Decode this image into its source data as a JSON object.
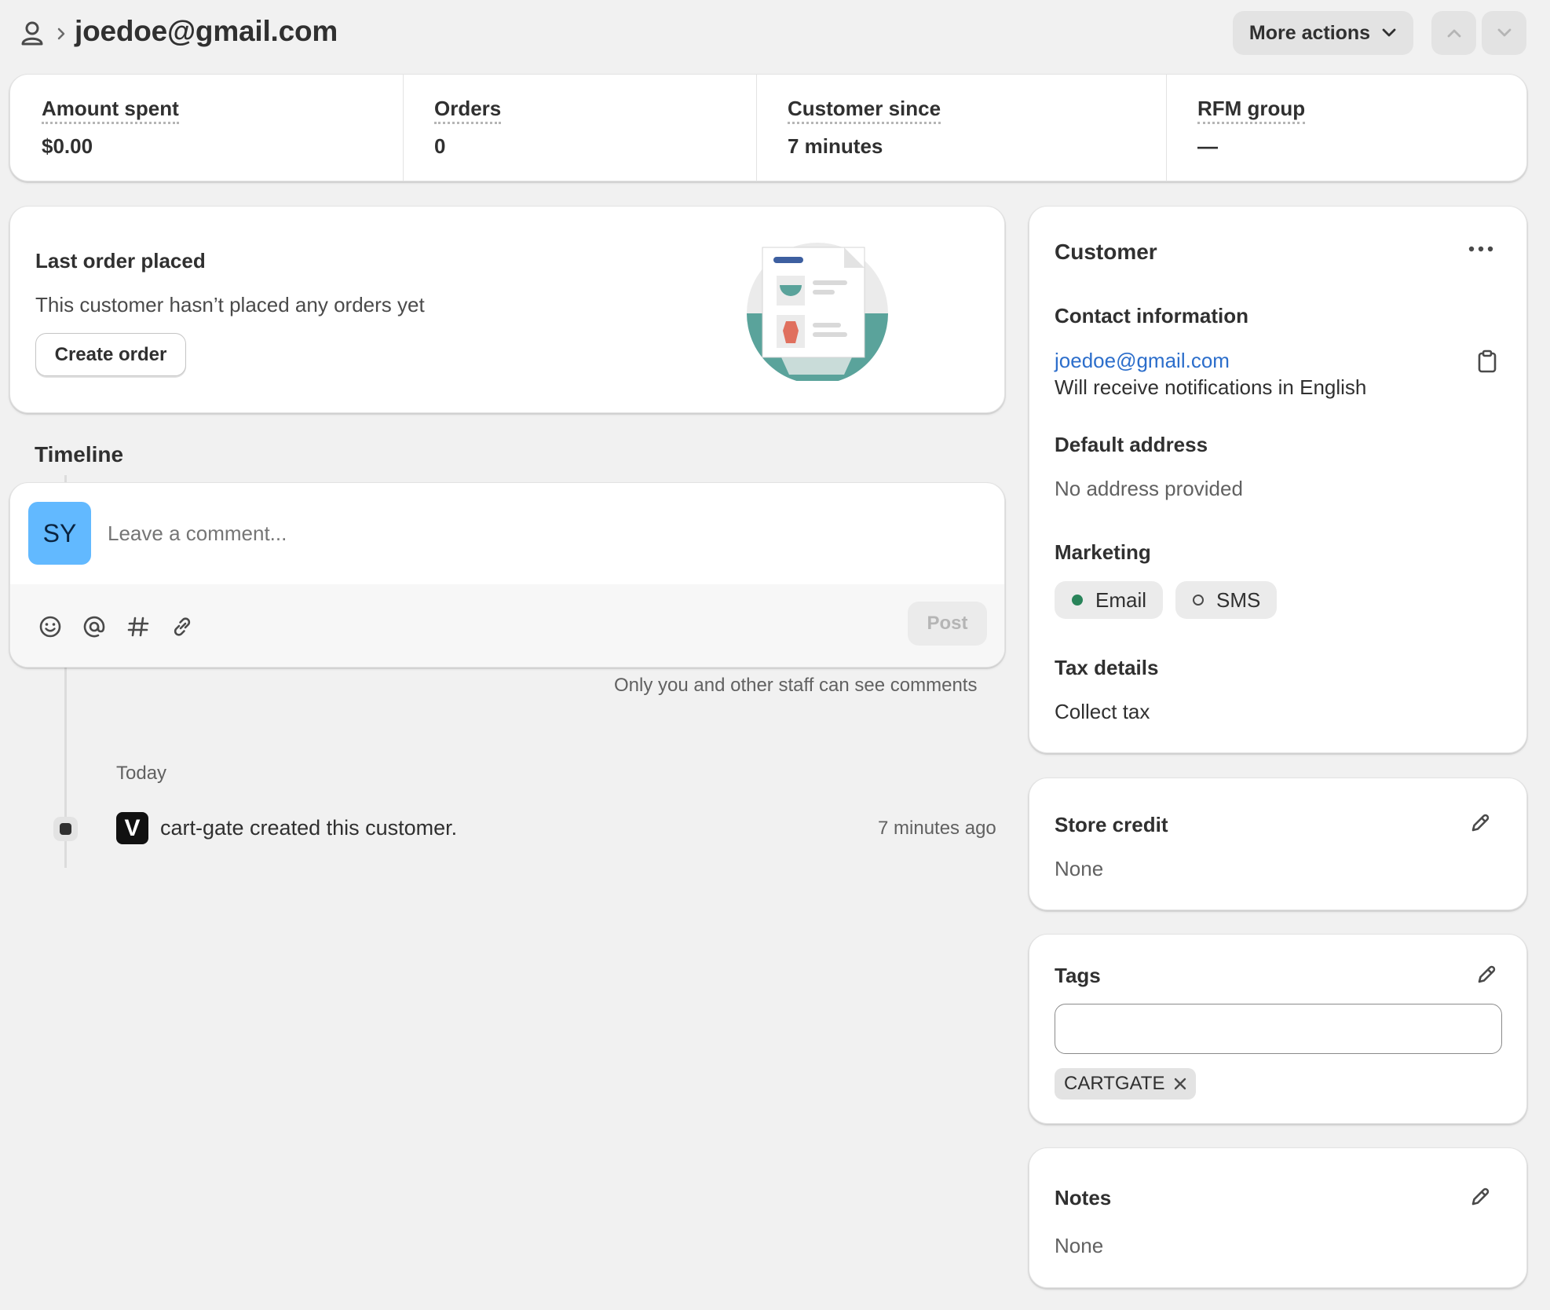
{
  "header": {
    "email": "joedoe@gmail.com",
    "more_actions_label": "More actions"
  },
  "stats": [
    {
      "label": "Amount spent",
      "value": "$0.00"
    },
    {
      "label": "Orders",
      "value": "0"
    },
    {
      "label": "Customer since",
      "value": "7 minutes"
    },
    {
      "label": "RFM group",
      "value": "—"
    }
  ],
  "last_order": {
    "title": "Last order placed",
    "message": "This customer hasn’t placed any orders yet",
    "create_order_label": "Create order"
  },
  "timeline": {
    "title": "Timeline",
    "avatar_initials": "SY",
    "comment_placeholder": "Leave a comment...",
    "post_label": "Post",
    "staff_note": "Only you and other staff can see comments",
    "day_label": "Today",
    "events": [
      {
        "text": "cart-gate created this customer.",
        "time": "7 minutes ago",
        "app_icon_letter": "V"
      }
    ]
  },
  "customer_card": {
    "title": "Customer",
    "contact_heading": "Contact information",
    "email": "joedoe@gmail.com",
    "notification_text": "Will receive notifications in English",
    "address_heading": "Default address",
    "address_text": "No address provided",
    "marketing_heading": "Marketing",
    "marketing_email_label": "Email",
    "marketing_sms_label": "SMS",
    "tax_heading": "Tax details",
    "tax_text": "Collect tax"
  },
  "store_credit": {
    "title": "Store credit",
    "value": "None"
  },
  "tags": {
    "title": "Tags",
    "input_value": "",
    "items": [
      "CARTGATE"
    ]
  },
  "notes": {
    "title": "Notes",
    "value": "None"
  },
  "colors": {
    "link": "#2c6ecb",
    "subscribed_dot": "#29845a",
    "avatar_bg": "#62b9ff",
    "page_bg": "#f1f1f1"
  }
}
